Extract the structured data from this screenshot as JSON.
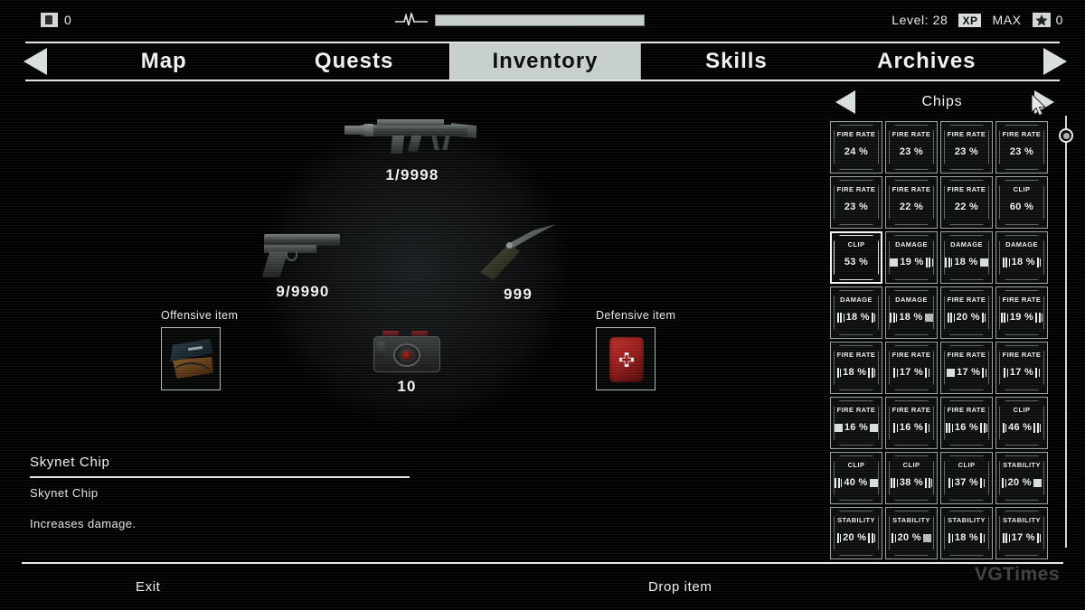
{
  "hud": {
    "coins_icon": "coins-icon",
    "coins_value": "0",
    "health_icon": "pulse-icon",
    "health_percent": 100,
    "level_label": "Level: 28",
    "xp_badge": "XP",
    "xp_state": "MAX",
    "star_icon": "star-icon",
    "star_value": "0"
  },
  "nav": {
    "prev_arrow": "chevron-left-icon",
    "next_arrow": "chevron-right-icon",
    "tabs": [
      {
        "label": "Map",
        "active": false
      },
      {
        "label": "Quests",
        "active": false
      },
      {
        "label": "Inventory",
        "active": true
      },
      {
        "label": "Skills",
        "active": false
      },
      {
        "label": "Archives",
        "active": false
      }
    ]
  },
  "loadout": {
    "primary_qty": "1/9998",
    "secondary_qty": "9/9990",
    "melee_qty": "999",
    "gadget_qty": "10",
    "offensive_label": "Offensive item",
    "defensive_label": "Defensive item"
  },
  "description": {
    "title": "Skynet Chip",
    "subtitle": "Skynet Chip",
    "body": "Increases damage."
  },
  "chips_panel": {
    "title": "Chips",
    "prev_arrow": "chevron-left-icon",
    "next_arrow": "chevron-right-icon",
    "rarity_colors": {
      "purple": "#a04fd8",
      "gold": "#e8d66a"
    },
    "items": [
      {
        "stat": "FIRE RATE",
        "value": "24 %",
        "rarity": "purple",
        "selected": false,
        "deco_left": "",
        "deco_right": ""
      },
      {
        "stat": "FIRE RATE",
        "value": "23 %",
        "rarity": "purple",
        "selected": false,
        "deco_left": "",
        "deco_right": ""
      },
      {
        "stat": "FIRE RATE",
        "value": "23 %",
        "rarity": "purple",
        "selected": false,
        "deco_left": "",
        "deco_right": ""
      },
      {
        "stat": "FIRE RATE",
        "value": "23 %",
        "rarity": "purple",
        "selected": false,
        "deco_left": "",
        "deco_right": ""
      },
      {
        "stat": "FIRE RATE",
        "value": "23 %",
        "rarity": "purple",
        "selected": false,
        "deco_left": "",
        "deco_right": ""
      },
      {
        "stat": "FIRE RATE",
        "value": "22 %",
        "rarity": "purple",
        "selected": false,
        "deco_left": "",
        "deco_right": ""
      },
      {
        "stat": "FIRE RATE",
        "value": "22 %",
        "rarity": "purple",
        "selected": false,
        "deco_left": "",
        "deco_right": ""
      },
      {
        "stat": "CLIP",
        "value": "60 %",
        "rarity": "purple",
        "selected": false,
        "deco_left": "",
        "deco_right": ""
      },
      {
        "stat": "CLIP",
        "value": "53 %",
        "rarity": "purple",
        "selected": true,
        "deco_left": "",
        "deco_right": ""
      },
      {
        "stat": "DAMAGE",
        "value": "19 %",
        "rarity": "gold",
        "selected": false,
        "deco_left": "sq",
        "deco_right": "bars3"
      },
      {
        "stat": "DAMAGE",
        "value": "18 %",
        "rarity": "gold",
        "selected": false,
        "deco_left": "bars3",
        "deco_right": "sq"
      },
      {
        "stat": "DAMAGE",
        "value": "18 %",
        "rarity": "gold",
        "selected": false,
        "deco_left": "bars3",
        "deco_right": "bars2"
      },
      {
        "stat": "DAMAGE",
        "value": "18 %",
        "rarity": "gold",
        "selected": false,
        "deco_left": "bars3",
        "deco_right": "bars2"
      },
      {
        "stat": "DAMAGE",
        "value": "18 %",
        "rarity": "gold",
        "selected": false,
        "deco_left": "bars3",
        "deco_right": "sqd"
      },
      {
        "stat": "FIRE RATE",
        "value": "20 %",
        "rarity": "gold",
        "selected": false,
        "deco_left": "bars3",
        "deco_right": "bars2"
      },
      {
        "stat": "FIRE RATE",
        "value": "19 %",
        "rarity": "gold",
        "selected": false,
        "deco_left": "bars3",
        "deco_right": "bars3"
      },
      {
        "stat": "FIRE RATE",
        "value": "18 %",
        "rarity": "gold",
        "selected": false,
        "deco_left": "bars2",
        "deco_right": "bars3"
      },
      {
        "stat": "FIRE RATE",
        "value": "17 %",
        "rarity": "gold",
        "selected": false,
        "deco_left": "bars2",
        "deco_right": "bars2"
      },
      {
        "stat": "FIRE RATE",
        "value": "17 %",
        "rarity": "gold",
        "selected": false,
        "deco_left": "sq",
        "deco_right": "bars2"
      },
      {
        "stat": "FIRE RATE",
        "value": "17 %",
        "rarity": "gold",
        "selected": false,
        "deco_left": "bars2",
        "deco_right": "bars2"
      },
      {
        "stat": "FIRE RATE",
        "value": "16 %",
        "rarity": "gold",
        "selected": false,
        "deco_left": "sq",
        "deco_right": "sq"
      },
      {
        "stat": "FIRE RATE",
        "value": "16 %",
        "rarity": "gold",
        "selected": false,
        "deco_left": "bars2",
        "deco_right": "bars2"
      },
      {
        "stat": "FIRE RATE",
        "value": "16 %",
        "rarity": "gold",
        "selected": false,
        "deco_left": "bars3",
        "deco_right": "bars3"
      },
      {
        "stat": "CLIP",
        "value": "46 %",
        "rarity": "gold",
        "selected": false,
        "deco_left": "bars2",
        "deco_right": "bars3"
      },
      {
        "stat": "CLIP",
        "value": "40 %",
        "rarity": "gold",
        "selected": false,
        "deco_left": "bars3",
        "deco_right": "sq"
      },
      {
        "stat": "CLIP",
        "value": "38 %",
        "rarity": "gold",
        "selected": false,
        "deco_left": "bars3",
        "deco_right": "bars3"
      },
      {
        "stat": "CLIP",
        "value": "37 %",
        "rarity": "gold",
        "selected": false,
        "deco_left": "bars2",
        "deco_right": "bars2"
      },
      {
        "stat": "STABILITY",
        "value": "20 %",
        "rarity": "gold",
        "selected": false,
        "deco_left": "bars2",
        "deco_right": "sq"
      },
      {
        "stat": "STABILITY",
        "value": "20 %",
        "rarity": "gold",
        "selected": false,
        "deco_left": "bars2",
        "deco_right": "bars3"
      },
      {
        "stat": "STABILITY",
        "value": "20 %",
        "rarity": "gold",
        "selected": false,
        "deco_left": "bars2",
        "deco_right": "sqd"
      },
      {
        "stat": "STABILITY",
        "value": "18 %",
        "rarity": "gold",
        "selected": false,
        "deco_left": "bars2",
        "deco_right": "bars2"
      },
      {
        "stat": "STABILITY",
        "value": "17 %",
        "rarity": "gold",
        "selected": false,
        "deco_left": "bars3",
        "deco_right": "bars2"
      }
    ]
  },
  "footer": {
    "exit_label": "Exit",
    "drop_label": "Drop item",
    "watermark": "VGTimes"
  }
}
